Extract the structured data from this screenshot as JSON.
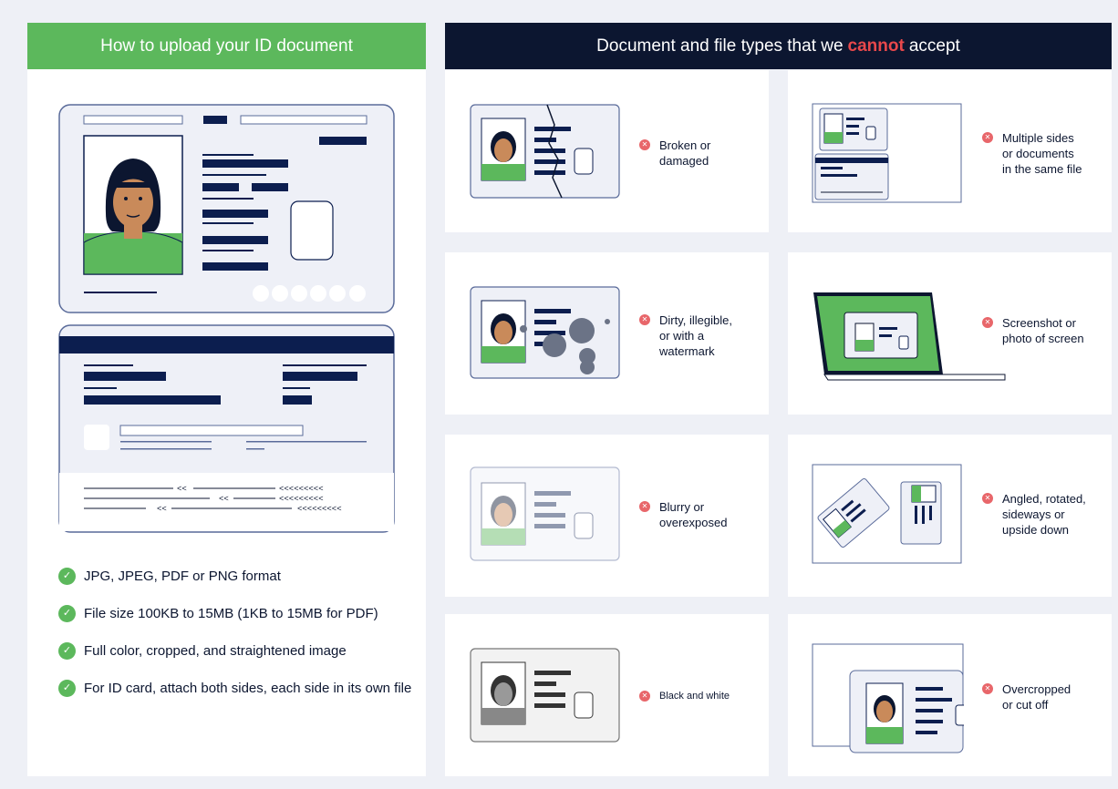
{
  "left": {
    "title": "How to upload your ID document",
    "requirements": [
      "JPG, JPEG, PDF or PNG format",
      "File size 100KB to 15MB (1KB to 15MB for PDF)",
      "Full color, cropped, and straightened image",
      "For ID card, attach both sides, each side in its own file"
    ]
  },
  "right": {
    "title_before": "Document and file types that we",
    "title_highlight": "cannot",
    "title_after": "accept",
    "items": [
      {
        "label": "Broken or\ndamaged",
        "icon": "broken-id-icon"
      },
      {
        "label": "Multiple sides\nor documents\nin the same file",
        "icon": "multiple-sides-icon"
      },
      {
        "label": "Dirty, illegible,\nor with a\nwatermark",
        "icon": "dirty-id-icon"
      },
      {
        "label": "Screenshot or\nphoto of screen",
        "icon": "laptop-screenshot-icon"
      },
      {
        "label": "Blurry or\noverexposed",
        "icon": "blurry-id-icon"
      },
      {
        "label": "Angled, rotated,\nsideways or\nupside down",
        "icon": "rotated-id-icon"
      },
      {
        "label": "Black and white",
        "icon": "black-white-id-icon"
      },
      {
        "label": "Overcropped\nor cut off",
        "icon": "overcropped-id-icon"
      }
    ]
  },
  "colors": {
    "green": "#5cb85c",
    "navy": "#0c1630",
    "red": "#e8484b",
    "card_outline": "#5a6b9a"
  },
  "mrz_back": [
    "<<",
    "<<<<<<<<<",
    "<<",
    "<<<<<<<<<",
    "<<",
    "<<<<<<<<<"
  ]
}
